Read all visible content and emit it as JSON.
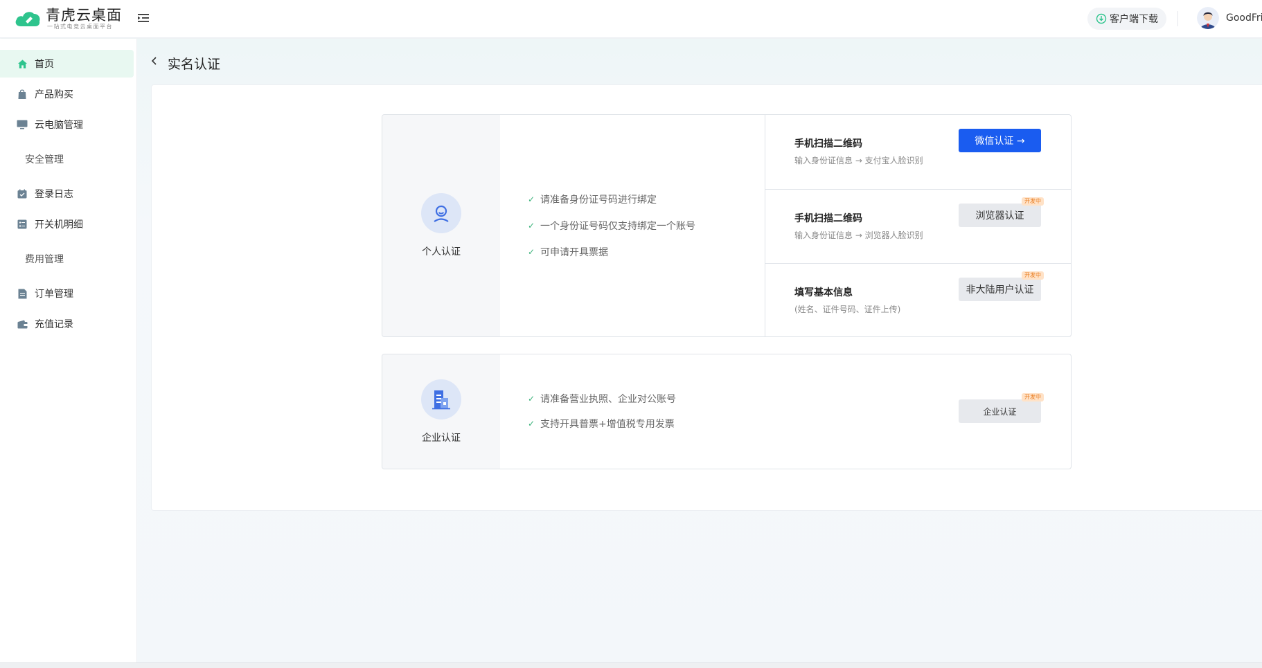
{
  "brand": {
    "title": "青虎云桌面",
    "subtitle": "一站式电竞云桌面平台",
    "accent": "#2ec48d"
  },
  "header": {
    "download_label": "客户端下载",
    "username": "GoodFrie"
  },
  "sidebar": {
    "items": [
      {
        "label": "首页",
        "icon": "home-icon",
        "active": true
      },
      {
        "label": "产品购买",
        "icon": "shopping-bag-icon"
      },
      {
        "label": "云电脑管理",
        "icon": "monitor-icon"
      },
      {
        "label": "安全管理",
        "group": true
      },
      {
        "label": "登录日志",
        "icon": "calendar-check-icon"
      },
      {
        "label": "开关机明细",
        "icon": "list-icon"
      },
      {
        "label": "费用管理",
        "group": true
      },
      {
        "label": "订单管理",
        "icon": "document-icon"
      },
      {
        "label": "充值记录",
        "icon": "wallet-icon"
      }
    ]
  },
  "page": {
    "title": "实名认证"
  },
  "personal": {
    "label": "个人认证",
    "requirements": [
      "请准备身份证号码进行绑定",
      "一个身份证号码仅支持绑定一个账号",
      "可申请开具票据"
    ],
    "options": [
      {
        "title": "手机扫描二维码",
        "desc": "输入身份证信息 → 支付宝人脸识别",
        "button": "微信认证 →",
        "style": "primary"
      },
      {
        "title": "手机扫描二维码",
        "desc": "输入身份证信息 → 浏览器人脸识别",
        "button": "浏览器认证",
        "badge": "开发中",
        "style": "gray"
      },
      {
        "title": "填写基本信息",
        "desc": "(姓名、证件号码、证件上传)",
        "button": "非大陆用户认证",
        "badge": "开发中",
        "style": "gray"
      }
    ]
  },
  "enterprise": {
    "label": "企业认证",
    "requirements": [
      "请准备营业执照、企业对公账号",
      "支持开具普票+增值税专用发票"
    ],
    "button": "企业认证",
    "badge": "开发中"
  },
  "colors": {
    "primary_button": "#1a5cf0",
    "check": "#3ab27a",
    "active_nav": "#e8f8f1",
    "badge_bg": "#ffe2c7",
    "badge_text": "#e97d22"
  }
}
